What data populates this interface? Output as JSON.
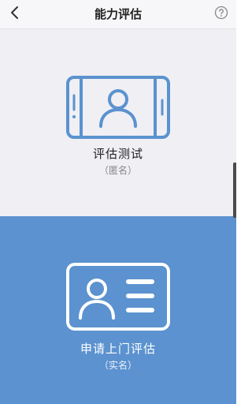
{
  "header": {
    "title": "能力评估",
    "back_icon": "chevron-left-icon",
    "help_icon": "help-circle-icon"
  },
  "options": [
    {
      "title": "评估测试",
      "subtitle": "（匿名）",
      "icon": "phone-user-icon",
      "background": "#efeff4",
      "icon_color": "#5b92cf"
    },
    {
      "title": "申请上门评估",
      "subtitle": "（实名）",
      "icon": "id-card-icon",
      "background": "#5b92cf",
      "icon_color": "#ffffff"
    }
  ]
}
